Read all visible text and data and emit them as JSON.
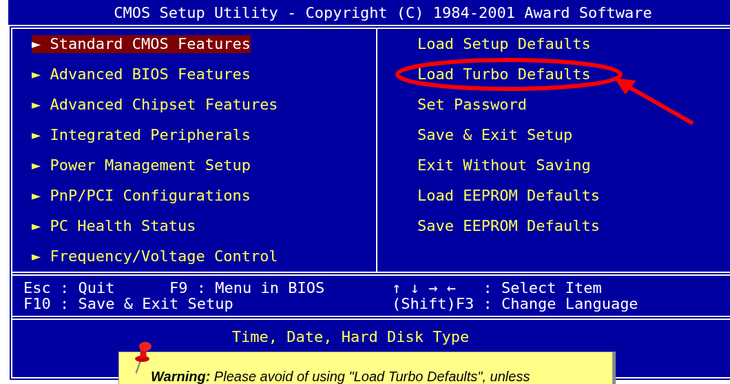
{
  "window": {
    "title": "CMOS Setup Utility - Copyright (C) 1984-2001 Award Software"
  },
  "left_menu": [
    {
      "arrow": "►",
      "label": "Standard CMOS Features",
      "selected": true
    },
    {
      "arrow": "►",
      "label": "Advanced BIOS Features",
      "selected": false
    },
    {
      "arrow": "►",
      "label": "Advanced Chipset Features",
      "selected": false
    },
    {
      "arrow": "►",
      "label": "Integrated Peripherals",
      "selected": false
    },
    {
      "arrow": "►",
      "label": "Power Management Setup",
      "selected": false
    },
    {
      "arrow": "►",
      "label": "PnP/PCI Configurations",
      "selected": false
    },
    {
      "arrow": "►",
      "label": "PC Health Status",
      "selected": false
    },
    {
      "arrow": "►",
      "label": "Frequency/Voltage Control",
      "selected": false
    }
  ],
  "right_menu": [
    {
      "label": "Load Setup Defaults",
      "circled": false
    },
    {
      "label": "Load Turbo Defaults",
      "circled": true
    },
    {
      "label": "Set Password",
      "circled": false
    },
    {
      "label": "Save & Exit Setup",
      "circled": false
    },
    {
      "label": "Exit Without Saving",
      "circled": false
    },
    {
      "label": "Load EEPROM Defaults",
      "circled": false
    },
    {
      "label": "Save EEPROM Defaults",
      "circled": false
    }
  ],
  "help": {
    "left": [
      [
        "Esc : Quit",
        "F9 : Menu in BIOS"
      ],
      [
        "F10 : Save & Exit Setup"
      ]
    ],
    "right": [
      "↑ ↓ → ←   : Select Item",
      "(Shift)F3 : Change Language"
    ]
  },
  "description": "Time, Date, Hard Disk Type",
  "note": {
    "text": "**Warning:** Please avoid of using \"Load Turbo Defaults\", unless"
  }
}
